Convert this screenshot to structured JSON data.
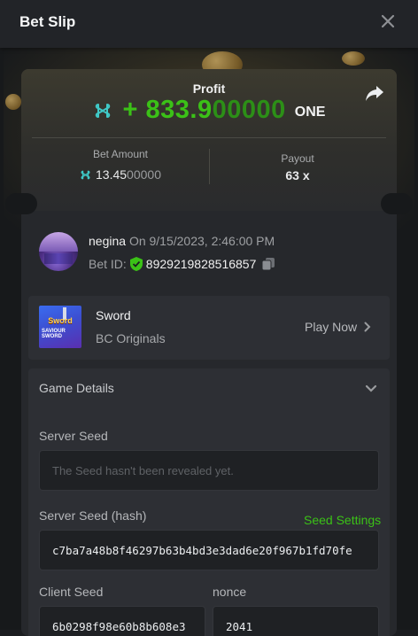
{
  "header": {
    "title": "Bet Slip",
    "close_icon": "close-icon"
  },
  "profit": {
    "label": "Profit",
    "prefix": "+",
    "amount_main": "833.9",
    "amount_faded": "00000",
    "currency": "ONE"
  },
  "bet_amount": {
    "label": "Bet Amount",
    "value_main": "13.45",
    "value_faded": "00000"
  },
  "payout": {
    "label": "Payout",
    "value": "63 x"
  },
  "user": {
    "name": "negina",
    "timestamp": "On 9/15/2023, 2:46:00 PM",
    "bet_id_label": "Bet ID:",
    "bet_id": "8929219828516857"
  },
  "game": {
    "name": "Sword",
    "provider": "BC Originals",
    "play_label": "Play Now",
    "thumb_title": "Sword",
    "thumb_sub": "SAVIOUR SWORD"
  },
  "details": {
    "title": "Game Details",
    "server_seed_label": "Server Seed",
    "server_seed_placeholder": "The Seed hasn't been revealed yet.",
    "server_seed_hash_label": "Server Seed (hash)",
    "seed_settings_label": "Seed Settings",
    "server_seed_hash": "c7ba7a48b8f46297b63b4bd3e3dad6e20f967b1fd70fe",
    "client_seed_label": "Client Seed",
    "client_seed": "6b0298f98e60b8b608e3",
    "nonce_label": "nonce",
    "nonce": "2041"
  },
  "colors": {
    "accent_green": "#3bc117",
    "background": "#1b1d20",
    "card": "#26282c"
  }
}
